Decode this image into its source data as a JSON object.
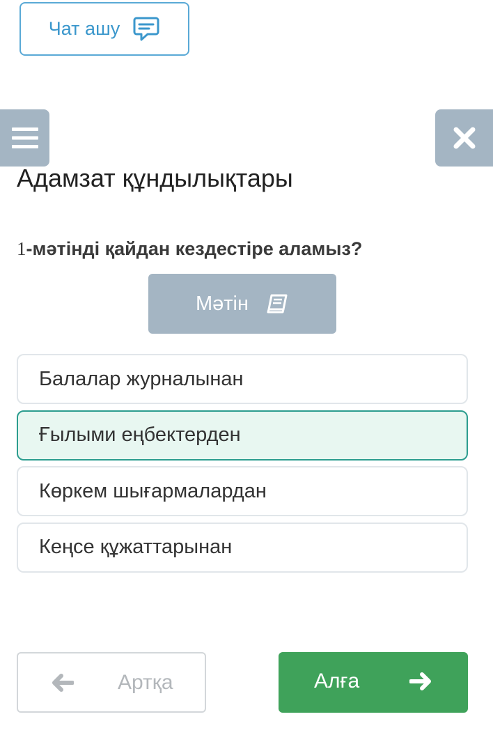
{
  "header": {
    "chat_label": "Чат ашу"
  },
  "page": {
    "title": "Адамзат құндылықтары"
  },
  "question": {
    "number": "1",
    "text": "-мәтінді қайдан кездестіре аламыз?"
  },
  "text_button": {
    "label": "Мәтін"
  },
  "options": [
    {
      "label": "Балалар журналынан",
      "selected": false
    },
    {
      "label": "Ғылыми еңбектерден",
      "selected": true
    },
    {
      "label": "Көркем шығармалардан",
      "selected": false
    },
    {
      "label": "Кеңсе құжаттарынан",
      "selected": false
    }
  ],
  "nav": {
    "back_label": "Артқа",
    "next_label": "Алға"
  },
  "colors": {
    "accent_blue": "#3b97cc",
    "gray_button": "#a4b5c3",
    "selected_border": "#2c9d8f",
    "selected_bg": "#e8f7f1",
    "next_green": "#3fa25a"
  },
  "icons": {
    "chat": "chat-bubble-icon",
    "menu": "hamburger-menu-icon",
    "close": "close-icon",
    "text": "book-icon",
    "back": "arrow-left-icon",
    "next": "arrow-right-icon"
  }
}
